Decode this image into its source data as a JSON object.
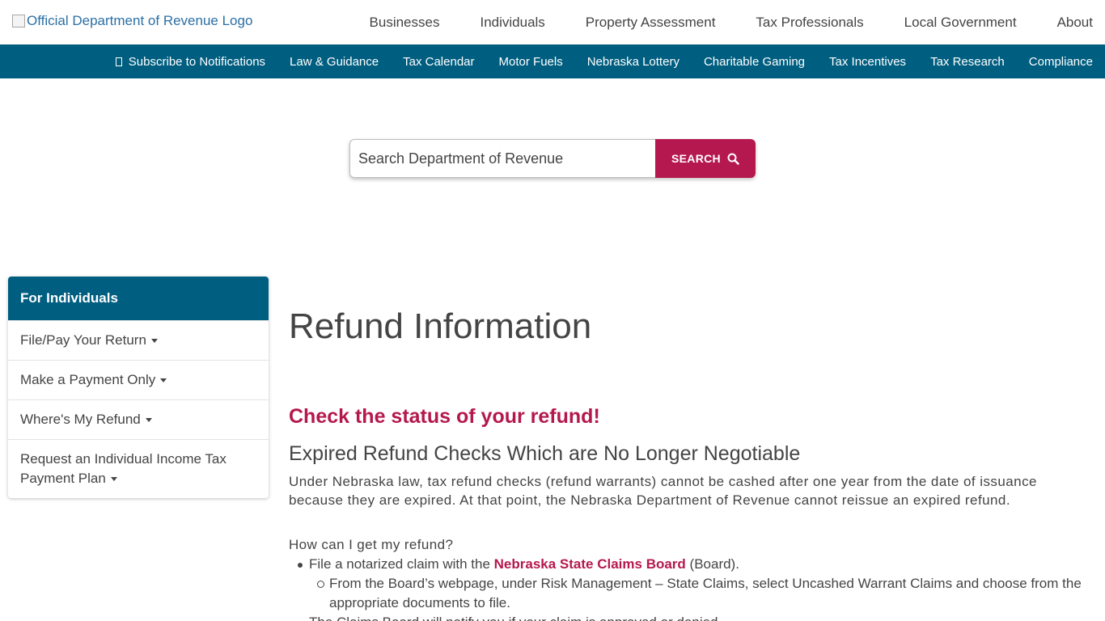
{
  "header": {
    "logo_alt": "Official Department of Revenue Logo",
    "nav": [
      "Businesses",
      "Individuals",
      "Property Assessment",
      "Tax Professionals",
      "Local Government",
      "About"
    ]
  },
  "subnav": {
    "items": [
      "Subscribe to Notifications",
      "Law & Guidance",
      "Tax Calendar",
      "Motor Fuels",
      "Nebraska Lottery",
      "Charitable Gaming",
      "Tax Incentives",
      "Tax Research",
      "Compliance"
    ],
    "accent": "#005e80"
  },
  "search": {
    "placeholder": "Search Department of Revenue",
    "button_label": "SEARCH",
    "button_color": "#b5184e"
  },
  "sidebar": {
    "title": "For Individuals",
    "items": [
      {
        "label": "File/Pay Your Return"
      },
      {
        "label": "Make a Payment Only"
      },
      {
        "label": "Where's My Refund"
      },
      {
        "label": "Request an Individual Income Tax Payment Plan"
      }
    ]
  },
  "main": {
    "title": "Refund Information",
    "check_heading": "Check the status of your refund!",
    "sub_heading": "Expired Refund Checks Which are No Longer Negotiable",
    "paragraph": "Under Nebraska law, tax refund checks (refund warrants) cannot be cashed after one year from the date of issuance because they are expired. At that point, the Nebraska Department of Revenue cannot reissue an expired refund.",
    "question": "How can I get my refund?",
    "bullet1_prefix": "File a notarized claim with the ",
    "bullet1_link": "Nebraska State Claims Board",
    "bullet1_suffix": " (Board).",
    "sub_bullet1": "From the Board’s webpage, under Risk Management – State Claims, select Uncashed Warrant Claims and choose from the appropriate documents to file.",
    "bullet2": "The Claims Board will notify you if your claim is approved or denied."
  }
}
